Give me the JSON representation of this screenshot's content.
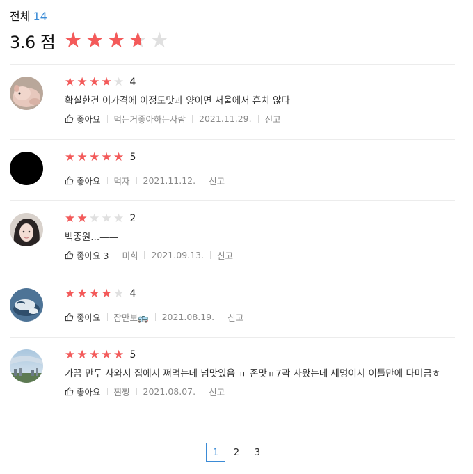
{
  "summary": {
    "label": "전체",
    "count": "14",
    "score": "3.6 점",
    "rating": 3.6
  },
  "colors": {
    "star_active": "#f45a5a",
    "star_inactive": "#e0e0e0",
    "accent": "#3b8bd6"
  },
  "reviews": [
    {
      "rating": 4,
      "rating_label": "4",
      "text": "확실한건 이가격에 이정도맛과 양이면 서울에서 흔치 않다",
      "like_label": "좋아요",
      "author": "먹는거좋아하는사람",
      "date": "2021.11.29.",
      "report_label": "신고",
      "avatar": "piglet-photo"
    },
    {
      "rating": 5,
      "rating_label": "5",
      "text": "",
      "like_label": "좋아요",
      "author": "먹자",
      "date": "2021.11.12.",
      "report_label": "신고",
      "avatar": "black-circle"
    },
    {
      "rating": 2,
      "rating_label": "2",
      "text": "백종원...——",
      "like_label": "좋아요 3",
      "author": "미희",
      "date": "2021.09.13.",
      "report_label": "신고",
      "avatar": "person-photo"
    },
    {
      "rating": 4,
      "rating_label": "4",
      "text": "",
      "like_label": "좋아요",
      "author": "잠만보🚌",
      "date": "2021.08.19.",
      "report_label": "신고",
      "avatar": "snorlax-illustration"
    },
    {
      "rating": 5,
      "rating_label": "5",
      "text": "가끔 만두 사와서 집에서 쪄먹는데 넘맛있음 ㅠ 존맛ㅠ7곽 사왔는데 세명이서 이틀만에 다머금ㅎ",
      "like_label": "좋아요",
      "author": "찐찡",
      "date": "2021.08.07.",
      "report_label": "신고",
      "avatar": "city-sky-photo"
    }
  ],
  "pagination": {
    "pages": [
      "1",
      "2",
      "3"
    ],
    "current": "1"
  }
}
